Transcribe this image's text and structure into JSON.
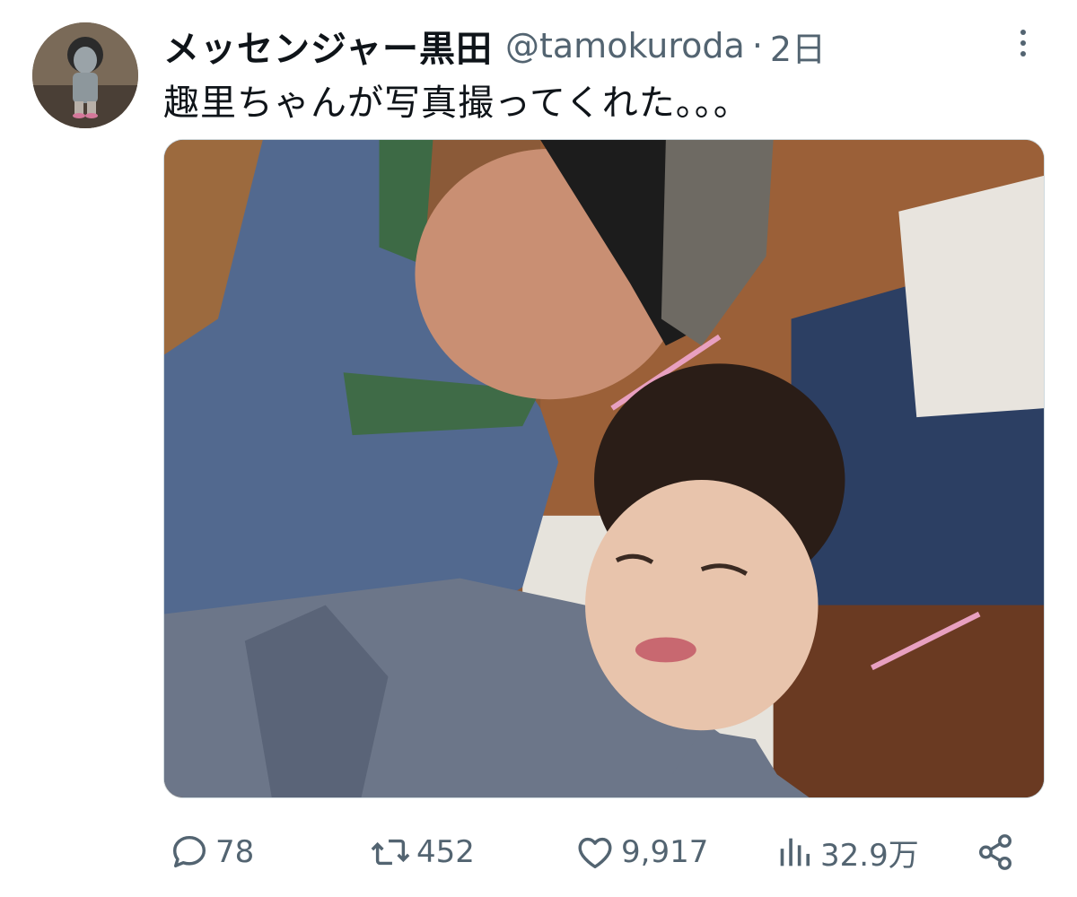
{
  "author": {
    "display_name": "メッセンジャー黒田",
    "handle": "@tamokuroda",
    "separator": "·",
    "time": "2日"
  },
  "tweet": {
    "text": "趣里ちゃんが写真撮ってくれた。。。"
  },
  "actions": {
    "replies": "78",
    "retweets": "452",
    "likes": "9,917",
    "views": "32.9万"
  },
  "icons": {
    "reply": "reply-bubble-icon",
    "retweet": "retweet-arrows-icon",
    "like": "heart-icon",
    "views": "bar-chart-icon",
    "share": "share-icon",
    "more": "more-dots-icon"
  },
  "colors": {
    "text_primary": "#0f1419",
    "text_secondary": "#536471",
    "border": "#cfd9de"
  }
}
